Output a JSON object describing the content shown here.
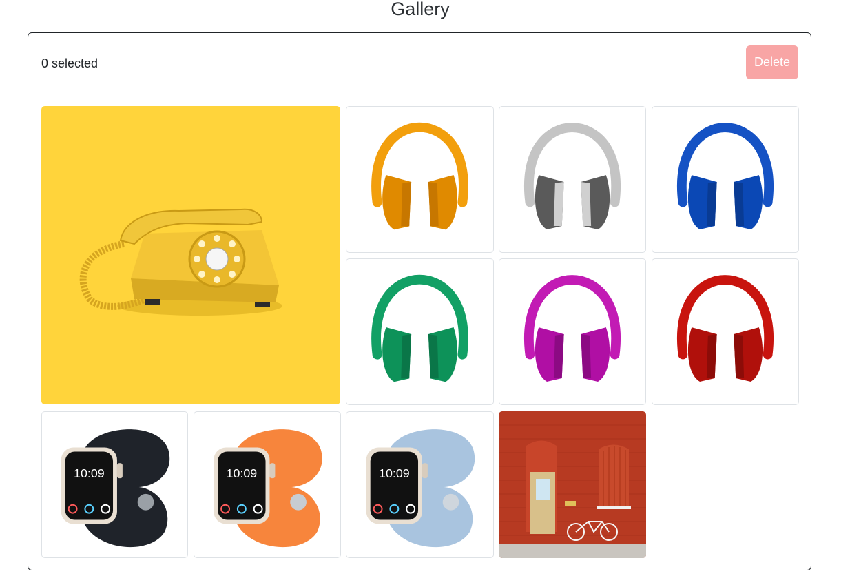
{
  "page": {
    "title": "Gallery"
  },
  "toolbar": {
    "selected_label": "0 selected",
    "delete_label": "Delete",
    "delete_color": "#f8a5a5"
  },
  "gallery": {
    "items": [
      {
        "name": "yellow-rotary-telephone",
        "bg": "#ffd43b",
        "main": "#f0c63a"
      },
      {
        "name": "headphones",
        "color": "#f29f0d",
        "dark": "#d98700"
      },
      {
        "name": "headphones",
        "color": "#bdbdbd",
        "dark": "#555555"
      },
      {
        "name": "headphones",
        "color": "#1552c4",
        "dark": "#0b3ea0"
      },
      {
        "name": "headphones",
        "color": "#12a065",
        "dark": "#0a8050"
      },
      {
        "name": "headphones",
        "color": "#c21bb4",
        "dark": "#a00a98"
      },
      {
        "name": "headphones",
        "color": "#c8140e",
        "dark": "#a00a08"
      },
      {
        "name": "smart-watch",
        "band": "#1f232a",
        "time": "10:09"
      },
      {
        "name": "smart-watch",
        "band": "#f7853c",
        "time": "10:09"
      },
      {
        "name": "smart-watch",
        "band": "#a9c4df",
        "time": "10:09"
      },
      {
        "name": "red-brick-building-with-bicycle",
        "bg": "#b73a22"
      }
    ]
  }
}
